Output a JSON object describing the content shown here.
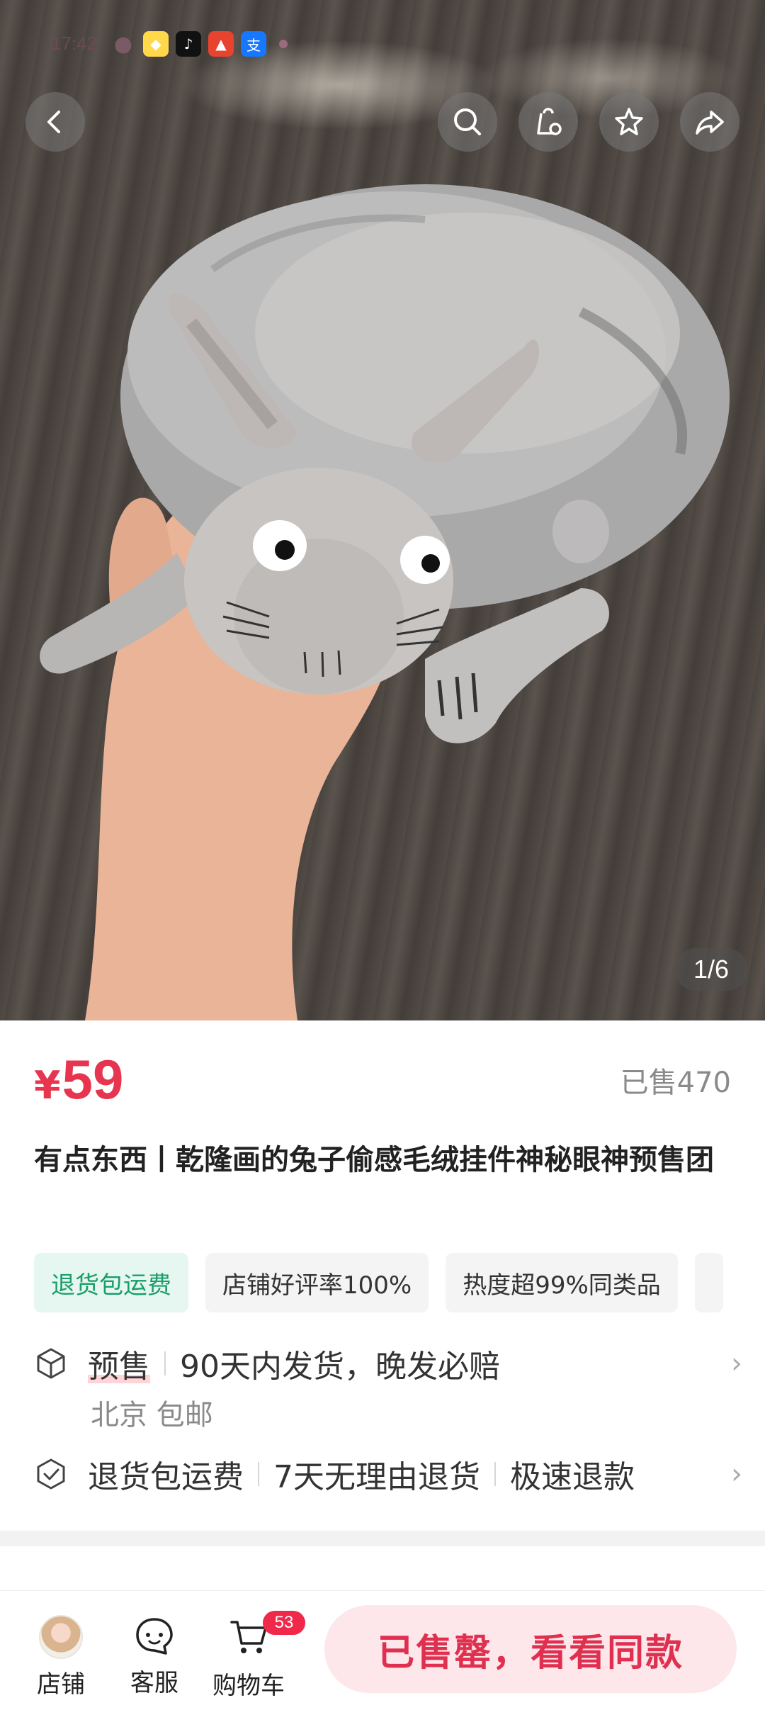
{
  "status_bar": {
    "time": "17:42",
    "icons": [
      "wechat-icon",
      "app-icon",
      "tiktok-icon",
      "red-app-icon",
      "alipay-icon",
      "notification-dot"
    ]
  },
  "top_actions": [
    "back-icon",
    "search-icon",
    "clipboard-icon",
    "favorite-star-icon",
    "share-icon"
  ],
  "gallery": {
    "indicator": "1/6"
  },
  "product": {
    "price_symbol": "¥",
    "price": "59",
    "sold": "已售470",
    "title": "有点东西丨乾隆画的兔子偷感毛绒挂件神秘眼神预售团",
    "tags": [
      "退货包运费",
      "店铺好评率100%",
      "热度超99%同类品"
    ]
  },
  "shipping": {
    "presale_label": "预售",
    "delivery_text": "90天内发货，晚发必赔",
    "origin": "北京 包邮"
  },
  "guarantee": {
    "items": [
      "退货包运费",
      "7天无理由退货",
      "极速退款"
    ]
  },
  "bottom_bar": {
    "shop_label": "店铺",
    "service_label": "客服",
    "cart_label": "购物车",
    "cart_count": "53",
    "main_button": "已售罄，看看同款"
  },
  "colors": {
    "accent": "#e8354f",
    "tag_green": "#1a9e6a",
    "button_bg": "#fde7ea"
  }
}
